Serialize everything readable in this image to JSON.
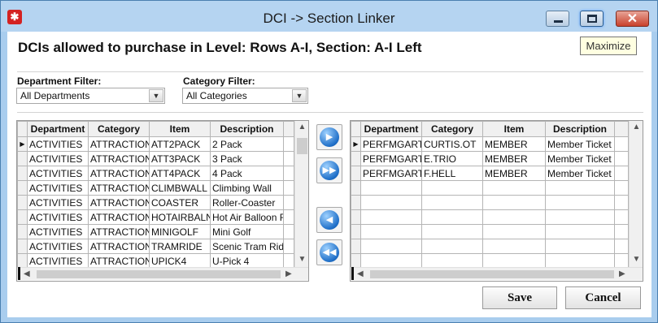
{
  "window": {
    "title": "DCI -> Section Linker",
    "tooltip": "Maximize"
  },
  "heading": "DCIs allowed to purchase in Level: Rows A-I, Section: A-I Left",
  "filters": {
    "department_label": "Department Filter:",
    "department_value": "All Departments",
    "category_label": "Category Filter:",
    "category_value": "All Categories"
  },
  "columns": [
    "Department",
    "Category",
    "Item",
    "Description"
  ],
  "left_grid": {
    "rows": [
      [
        "ACTIVITIES",
        "ATTRACTION",
        "ATT2PACK",
        "2 Pack"
      ],
      [
        "ACTIVITIES",
        "ATTRACTION",
        "ATT3PACK",
        "3 Pack"
      ],
      [
        "ACTIVITIES",
        "ATTRACTION",
        "ATT4PACK",
        "4 Pack"
      ],
      [
        "ACTIVITIES",
        "ATTRACTION",
        "CLIMBWALL",
        "Climbing Wall"
      ],
      [
        "ACTIVITIES",
        "ATTRACTION",
        "COASTER",
        "Roller-Coaster"
      ],
      [
        "ACTIVITIES",
        "ATTRACTION",
        "HOTAIRBALN",
        "Hot Air Balloon R"
      ],
      [
        "ACTIVITIES",
        "ATTRACTION",
        "MINIGOLF",
        "Mini Golf"
      ],
      [
        "ACTIVITIES",
        "ATTRACTION",
        "TRAMRIDE",
        "Scenic Tram Ride"
      ],
      [
        "ACTIVITIES",
        "ATTRACTION",
        "UPICK4",
        "U-Pick 4"
      ]
    ]
  },
  "right_grid": {
    "rows": [
      [
        "PERFMGART",
        "CURTIS.OT",
        "MEMBER",
        "Member Ticket"
      ],
      [
        "PERFMGART",
        "E.TRIO",
        "MEMBER",
        "Member Ticket"
      ],
      [
        "PERFMGART",
        "F.HELL",
        "MEMBER",
        "Member Ticket"
      ],
      [
        "",
        "",
        "",
        ""
      ],
      [
        "",
        "",
        "",
        ""
      ],
      [
        "",
        "",
        "",
        ""
      ],
      [
        "",
        "",
        "",
        ""
      ],
      [
        "",
        "",
        "",
        ""
      ],
      [
        "",
        "",
        "",
        ""
      ]
    ]
  },
  "buttons": {
    "save": "Save",
    "cancel": "Cancel"
  },
  "icons": {
    "app": "app-star-icon",
    "move_one_right": "arrow-right-icon",
    "move_all_right": "double-arrow-right-icon",
    "move_one_left": "arrow-left-icon",
    "move_all_left": "double-arrow-left-icon"
  }
}
